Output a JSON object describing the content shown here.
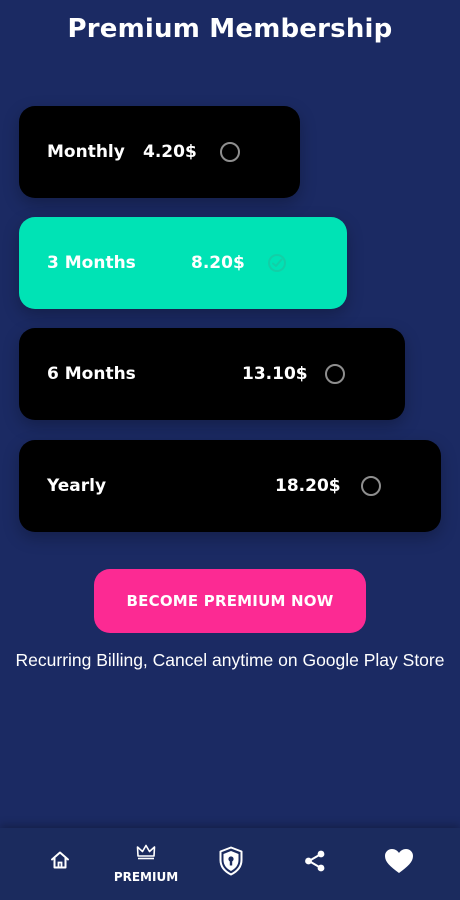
{
  "header": {
    "title": "Premium Membership"
  },
  "plans": [
    {
      "name": "Monthly",
      "price": "4.20$",
      "selected": false
    },
    {
      "name": "3 Months",
      "price": "8.20$",
      "selected": true
    },
    {
      "name": "6 Months",
      "price": "13.10$",
      "selected": false
    },
    {
      "name": "Yearly",
      "price": "18.20$",
      "selected": false
    }
  ],
  "cta": {
    "label": "BECOME PREMIUM NOW"
  },
  "billing_note": "Recurring Billing, Cancel anytime on Google Play Store",
  "bottom_nav": {
    "items": [
      {
        "icon": "home-icon",
        "label": ""
      },
      {
        "icon": "crown-icon",
        "label": "PREMIUM"
      },
      {
        "icon": "shield-lock-icon",
        "label": ""
      },
      {
        "icon": "share-icon",
        "label": ""
      },
      {
        "icon": "heart-icon",
        "label": ""
      }
    ]
  },
  "colors": {
    "background": "#1b2a63",
    "selected_card": "#00e3b5",
    "card": "#000000",
    "cta": "#fc2a93"
  }
}
